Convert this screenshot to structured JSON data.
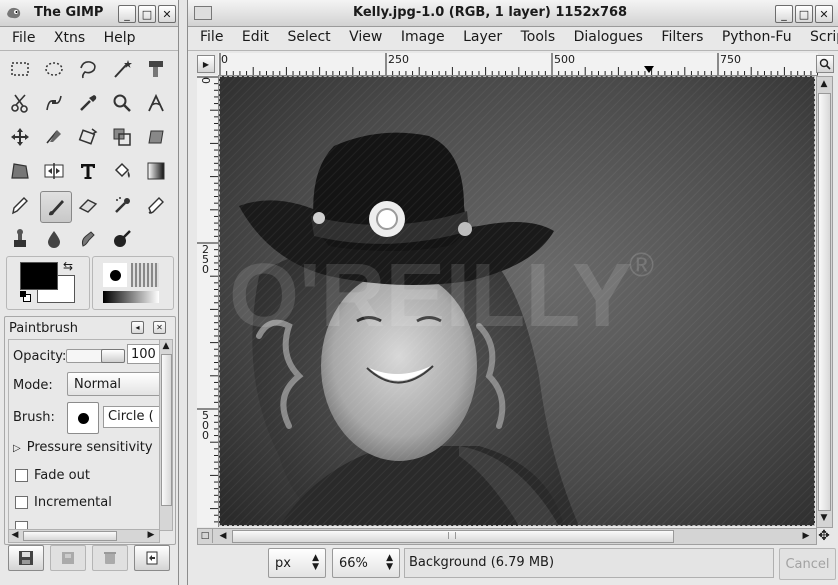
{
  "toolbox": {
    "title": "The GIMP",
    "menu": [
      "File",
      "Xtns",
      "Help"
    ],
    "tools": [
      "rect-select-icon",
      "ellipse-select-icon",
      "lasso-icon",
      "magic-wand-icon",
      "select-by-color-icon",
      "scissors-icon",
      "paths-icon",
      "color-picker-icon",
      "zoom-icon",
      "measure-icon",
      "move-icon",
      "crop-icon",
      "rotate-icon",
      "scale-icon",
      "shear-icon",
      "perspective-icon",
      "flip-icon",
      "text-icon",
      "bucket-fill-icon",
      "blend-icon",
      "pencil-icon",
      "paintbrush-icon",
      "eraser-icon",
      "airbrush-icon",
      "ink-icon",
      "clone-icon",
      "blur-icon",
      "smudge-icon",
      "dodge-burn-icon"
    ],
    "colors": {
      "foreground": "#000000",
      "background": "#ffffff"
    }
  },
  "tool_options": {
    "title": "Paintbrush",
    "opacity_label": "Opacity:",
    "opacity_value": "100",
    "opacity_level": 1.0,
    "mode_label": "Mode:",
    "mode_value": "Normal",
    "brush_label": "Brush:",
    "brush_value": "Circle (",
    "pressure_label": "Pressure sensitivity",
    "fade_label": "Fade out",
    "incremental_label": "Incremental"
  },
  "image_window": {
    "title": "Kelly.jpg-1.0 (RGB, 1 layer) 1152x768",
    "menu": [
      "File",
      "Edit",
      "Select",
      "View",
      "Image",
      "Layer",
      "Tools",
      "Dialogues",
      "Filters",
      "Python-Fu",
      "Script-Fu"
    ],
    "ruler_h_labels": [
      "0",
      "250",
      "500",
      "750"
    ],
    "ruler_v_labels": [
      "0",
      "250",
      "500"
    ],
    "watermark": "O'REILLY",
    "unit_value": "px",
    "zoom_value": "66%",
    "status_text": "Background (6.79 MB)",
    "cancel_label": "Cancel"
  }
}
